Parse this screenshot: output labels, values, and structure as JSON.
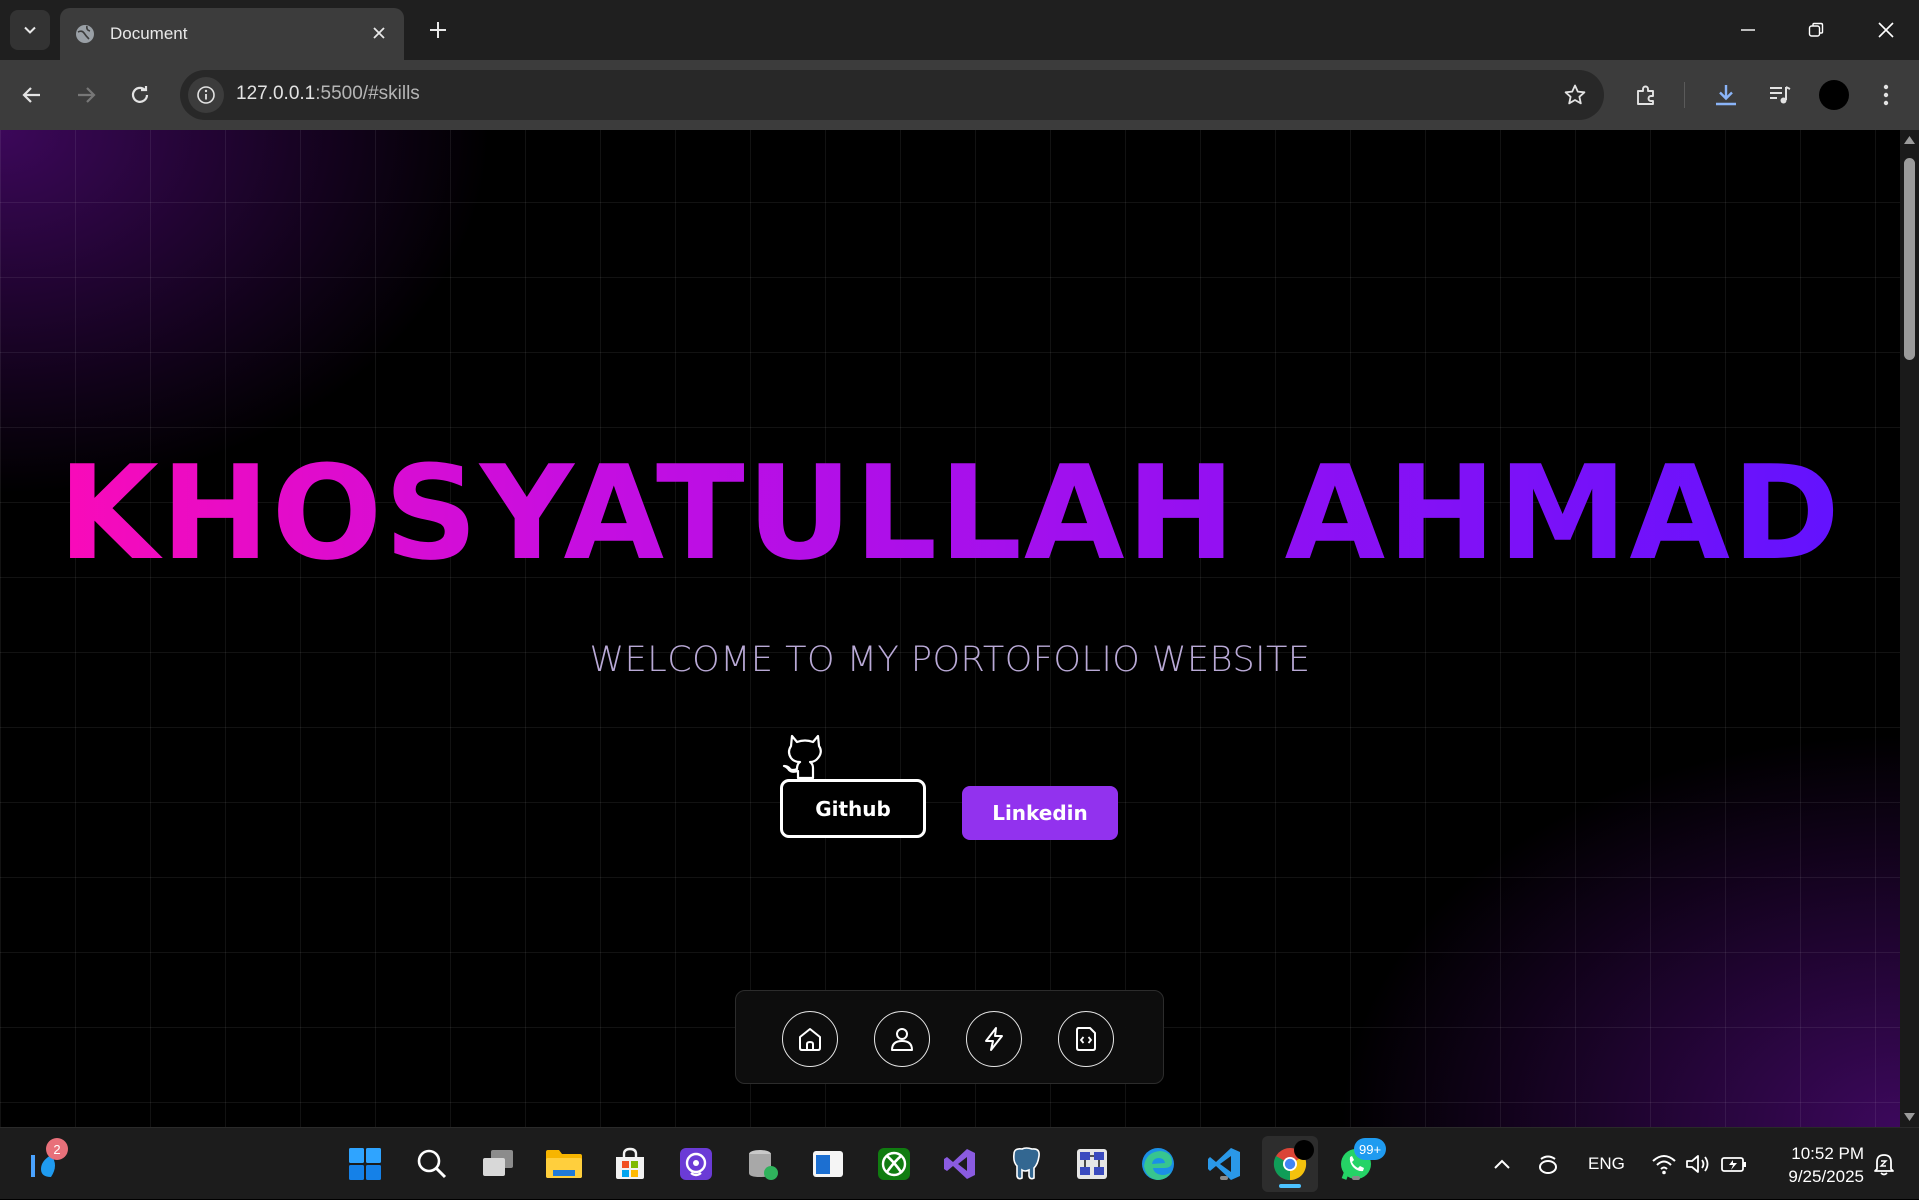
{
  "browser": {
    "tab_title": "Document",
    "url_host": "127.0.0.1",
    "url_path": ":5500/#skills"
  },
  "hero": {
    "name": "KHOSYATULLAH AHMAD",
    "subtitle": "WELCOME TO MY PORTOFOLIO WEBSITE",
    "github_label": "Github",
    "linkedin_label": "Linkedin"
  },
  "dock": {
    "items": [
      "home-icon",
      "user-icon",
      "lightning-icon",
      "code-file-icon"
    ]
  },
  "taskbar": {
    "weather_badge": "2",
    "whatsapp_badge": "99+",
    "language": "ENG",
    "time": "10:52 PM",
    "date": "9/25/2025"
  },
  "colors": {
    "accent": "#9232ee",
    "title_gradient_start": "#ff0ab4",
    "title_gradient_end": "#5e12ff",
    "subtitle": "#b9a9d6"
  }
}
